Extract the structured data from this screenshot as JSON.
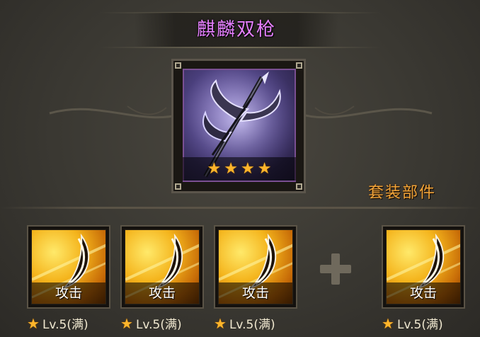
{
  "item": {
    "name": "麒麟双枪",
    "name_color": "#e680ff",
    "icon": "twin-spear-weapon-icon",
    "stars": [
      "★",
      "★",
      "★",
      "★"
    ]
  },
  "set_section": {
    "label": "套装部件",
    "label_color": "#f0a43a"
  },
  "slots": [
    {
      "label": "攻击",
      "icon": "claw-slash-icon",
      "star": "★",
      "level": "Lv.5(满)"
    },
    {
      "label": "攻击",
      "icon": "claw-slash-icon",
      "star": "★",
      "level": "Lv.5(满)"
    },
    {
      "label": "攻击",
      "icon": "claw-slash-icon",
      "star": "★",
      "level": "Lv.5(满)"
    },
    {
      "label": "攻击",
      "icon": "claw-slash-icon",
      "star": "★",
      "level": "Lv.5(满)"
    }
  ],
  "plus_icon": "plus-icon"
}
